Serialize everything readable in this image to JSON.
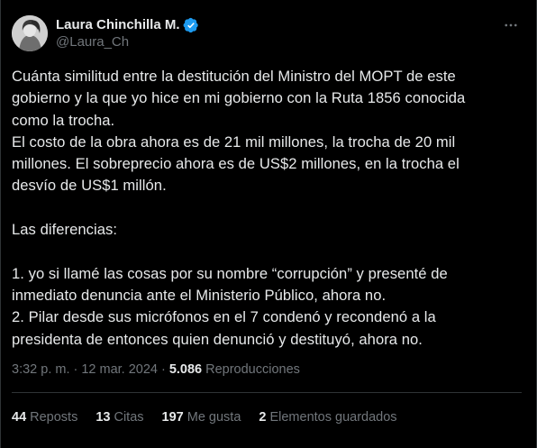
{
  "author": {
    "display_name": "Laura Chinchilla M.",
    "handle": "@Laura_Ch",
    "verified_icon": "verified-badge-icon",
    "accent_color": "#1d9bf0"
  },
  "more_icon": "more-icon",
  "tweet": {
    "text": "Cuánta similitud entre la destitución del Ministro del MOPT de este\ngobierno y la que yo hice en mi gobierno con la Ruta 1856 conocida\ncomo la trocha.\nEl costo de la obra ahora es de 21 mil millones, la trocha de 20 mil\nmillones. El sobreprecio ahora es de US$2 millones, en la trocha el\ndesvío de US$1 millón.\n\nLas diferencias:\n\n1. yo si llamé las cosas por su nombre “corrupción” y presenté de\ninmediato denuncia ante el Ministerio Público, ahora no.\n2. Pilar desde sus micrófonos en el 7 condenó y recondenó a la\npresidenta de entonces quien denunció y destituyó, ahora no."
  },
  "meta": {
    "time": "3:32 p. m.",
    "separator1": "·",
    "date": "12 mar. 2024",
    "separator2": "·",
    "views_count": "5.086",
    "views_label": "Reproducciones"
  },
  "stats": {
    "reposts_count": "44",
    "reposts_label": "Reposts",
    "quotes_count": "13",
    "quotes_label": "Citas",
    "likes_count": "197",
    "likes_label": "Me gusta",
    "bookmarks_count": "2",
    "bookmarks_label": "Elementos guardados"
  },
  "colors": {
    "background": "#000000",
    "text_primary": "#e7e9ea",
    "text_secondary": "#71767b",
    "divider": "#2f3336"
  }
}
